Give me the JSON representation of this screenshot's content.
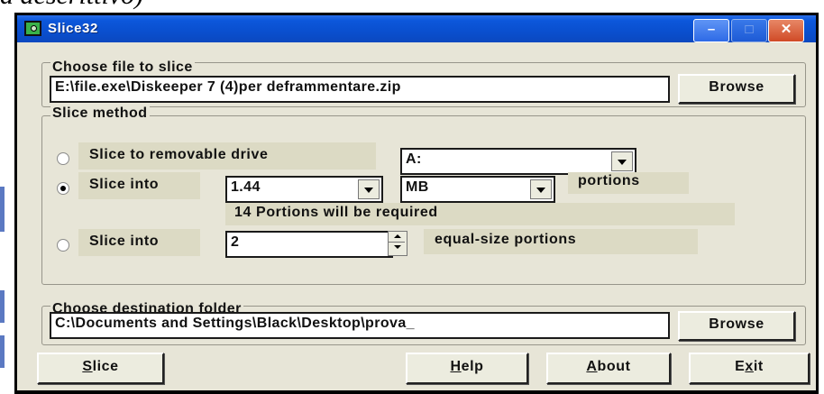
{
  "background_text": "a descrittivo)",
  "window": {
    "title": "Slice32",
    "controls": {
      "minimize": "–",
      "maximize": "□",
      "close": "✕"
    }
  },
  "file_group": {
    "legend": "Choose file to slice",
    "file_path": "E:\\file.exe\\Diskeeper 7 (4)per deframmentare.zip",
    "browse_label": "Browse"
  },
  "method_group": {
    "legend": "Slice method",
    "option_drive": {
      "label": "Slice to removable drive",
      "selected": false,
      "drive": "A:"
    },
    "option_size": {
      "label": "Slice into",
      "selected": true,
      "size": "1.44",
      "unit": "MB",
      "suffix": "portions"
    },
    "portions_message": "14 Portions will be required",
    "option_equal": {
      "label": "Slice into",
      "selected": false,
      "count": "2",
      "suffix": "equal-size portions"
    }
  },
  "dest_group": {
    "legend": "Choose destination folder",
    "folder_path": "C:\\Documents and Settings\\Black\\Desktop\\prova_",
    "browse_label": "Browse"
  },
  "buttons": {
    "slice": {
      "label": "Slice",
      "mnemonic": "S"
    },
    "help": {
      "label": "Help",
      "mnemonic": "H"
    },
    "about": {
      "label": "About",
      "mnemonic": "A"
    },
    "exit": {
      "label": "Exit",
      "mnemonic": "x"
    }
  },
  "colors": {
    "titlebar": "#0b52d6",
    "window_bg": "#e7e5d7",
    "close_button": "#d04a26"
  }
}
